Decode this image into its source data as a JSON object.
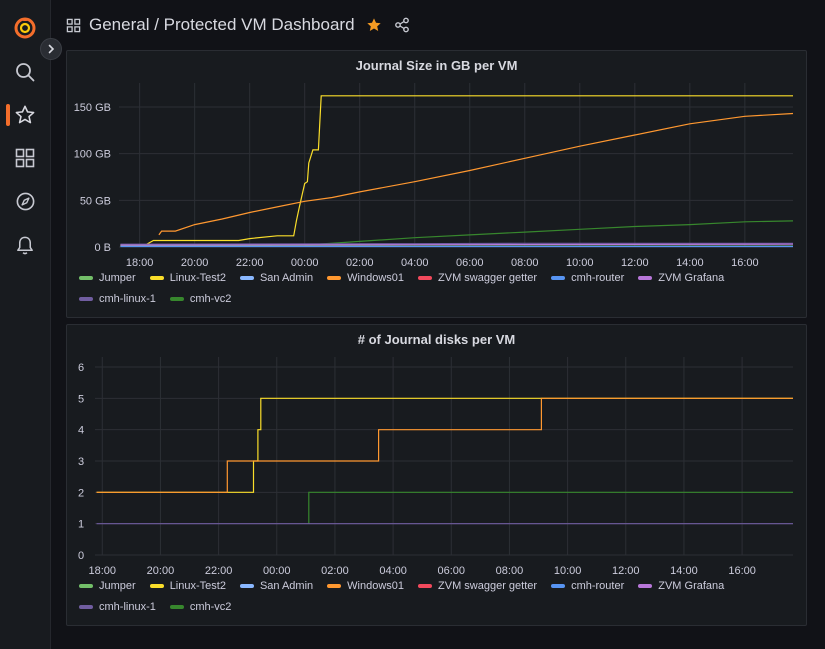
{
  "breadcrumb": {
    "folder": "General",
    "separator": " / ",
    "dashboard": "Protected VM Dashboard"
  },
  "sidebar": {
    "items": [
      "grafana-logo",
      "search",
      "starred",
      "dashboards",
      "explore",
      "alerting"
    ]
  },
  "colors": {
    "Jumper": "#73bf69",
    "Linux-Test2": "#fade2a",
    "San Admin": "#8ab8ff",
    "Windows01": "#ff9830",
    "ZVM swagger getter": "#f2495c",
    "cmh-router": "#5794f2",
    "ZVM Grafana": "#b877d9",
    "cmh-linux-1": "#705da0",
    "cmh-vc2": "#37872d"
  },
  "legend": [
    "Jumper",
    "Linux-Test2",
    "San Admin",
    "Windows01",
    "ZVM swagger getter",
    "cmh-router",
    "ZVM Grafana",
    "cmh-linux-1",
    "cmh-vc2"
  ],
  "chart_data": [
    {
      "type": "line",
      "title": "Journal Size in GB per VM",
      "x_ticks": [
        "18:00",
        "20:00",
        "22:00",
        "00:00",
        "02:00",
        "04:00",
        "06:00",
        "08:00",
        "10:00",
        "12:00",
        "14:00",
        "16:00"
      ],
      "y_ticks": [
        "0 B",
        "50 GB",
        "100 GB",
        "150 GB"
      ],
      "y_tick_values": [
        0,
        50,
        100,
        150
      ],
      "ylim": [
        0,
        165
      ],
      "x_unit": "hours since 18:00",
      "xlim": [
        -0.75,
        23.75
      ],
      "grid": true,
      "legend_position": "bottom",
      "series": [
        {
          "name": "Linux-Test2",
          "points": [
            [
              -0.7,
              2
            ],
            [
              0.2,
              2
            ],
            [
              0.5,
              7
            ],
            [
              1.2,
              7
            ],
            [
              1.5,
              7
            ],
            [
              3.6,
              7
            ],
            [
              4.0,
              9
            ],
            [
              5.0,
              12
            ],
            [
              5.6,
              12
            ],
            [
              5.7,
              28
            ],
            [
              5.8,
              42
            ],
            [
              5.9,
              55
            ],
            [
              6.0,
              68
            ],
            [
              6.1,
              70
            ],
            [
              6.15,
              90
            ],
            [
              6.3,
              104
            ],
            [
              6.5,
              104
            ],
            [
              6.6,
              162
            ],
            [
              23.75,
              162
            ]
          ]
        },
        {
          "name": "Windows01",
          "points": [
            [
              0.7,
              13
            ],
            [
              0.8,
              17
            ],
            [
              1.3,
              17
            ],
            [
              2.0,
              24
            ],
            [
              3.0,
              30
            ],
            [
              4.0,
              37
            ],
            [
              5.0,
              43
            ],
            [
              6.0,
              49
            ],
            [
              7.0,
              53
            ],
            [
              8.0,
              59
            ],
            [
              10.0,
              70
            ],
            [
              12.0,
              82
            ],
            [
              14.0,
              95
            ],
            [
              16.0,
              108
            ],
            [
              18.0,
              120
            ],
            [
              20.0,
              132
            ],
            [
              22.0,
              140
            ],
            [
              23.75,
              143
            ]
          ]
        },
        {
          "name": "cmh-vc2",
          "points": [
            [
              6.0,
              2
            ],
            [
              8.0,
              6
            ],
            [
              10.0,
              10
            ],
            [
              12.0,
              13
            ],
            [
              14.0,
              16
            ],
            [
              16.0,
              19
            ],
            [
              18.0,
              22
            ],
            [
              20.0,
              24
            ],
            [
              22.0,
              27
            ],
            [
              23.75,
              28
            ]
          ]
        },
        {
          "name": "Jumper",
          "points": [
            [
              -0.7,
              1
            ],
            [
              23.75,
              1
            ]
          ]
        },
        {
          "name": "cmh-linux-1",
          "points": [
            [
              -0.7,
              3
            ],
            [
              10.0,
              3.5
            ],
            [
              14.0,
              4
            ],
            [
              23.75,
              4
            ]
          ]
        },
        {
          "name": "ZVM Grafana",
          "points": [
            [
              -0.7,
              2
            ],
            [
              10.0,
              2.5
            ],
            [
              23.75,
              3
            ]
          ]
        },
        {
          "name": "cmh-router",
          "points": [
            [
              -0.7,
              0.5
            ],
            [
              23.75,
              0.5
            ]
          ]
        }
      ]
    },
    {
      "type": "line",
      "title": "# of Journal disks per VM",
      "x_ticks": [
        "18:00",
        "20:00",
        "22:00",
        "00:00",
        "02:00",
        "04:00",
        "06:00",
        "08:00",
        "10:00",
        "12:00",
        "14:00",
        "16:00"
      ],
      "y_ticks": [
        "0",
        "1",
        "2",
        "3",
        "4",
        "5",
        "6"
      ],
      "y_tick_values": [
        0,
        1,
        2,
        3,
        4,
        5,
        6
      ],
      "ylim": [
        0,
        6
      ],
      "x_unit": "hours since 18:00",
      "xlim": [
        -0.25,
        23.75
      ],
      "grid": true,
      "legend_position": "bottom",
      "series": [
        {
          "name": "Linux-Test2",
          "points": [
            [
              -0.2,
              2
            ],
            [
              1.5,
              2
            ],
            [
              2.4,
              2
            ],
            [
              4.5,
              2
            ],
            [
              5.2,
              2
            ],
            [
              5.2,
              3
            ],
            [
              5.35,
              3
            ],
            [
              5.35,
              4
            ],
            [
              5.45,
              4
            ],
            [
              5.45,
              5
            ],
            [
              23.75,
              5
            ]
          ]
        },
        {
          "name": "Windows01",
          "points": [
            [
              -0.2,
              2
            ],
            [
              4.3,
              2
            ],
            [
              4.3,
              3
            ],
            [
              9.5,
              3
            ],
            [
              9.5,
              4
            ],
            [
              14.1,
              4
            ],
            [
              14.1,
              4
            ],
            [
              15.1,
              4
            ],
            [
              15.1,
              5
            ],
            [
              23.75,
              5
            ]
          ]
        },
        {
          "name": "cmh-vc2",
          "points": [
            [
              7.1,
              1
            ],
            [
              7.1,
              2
            ],
            [
              23.75,
              2
            ]
          ]
        },
        {
          "name": "cmh-linux-1",
          "points": [
            [
              -0.2,
              1
            ],
            [
              23.75,
              1
            ]
          ]
        }
      ]
    }
  ]
}
